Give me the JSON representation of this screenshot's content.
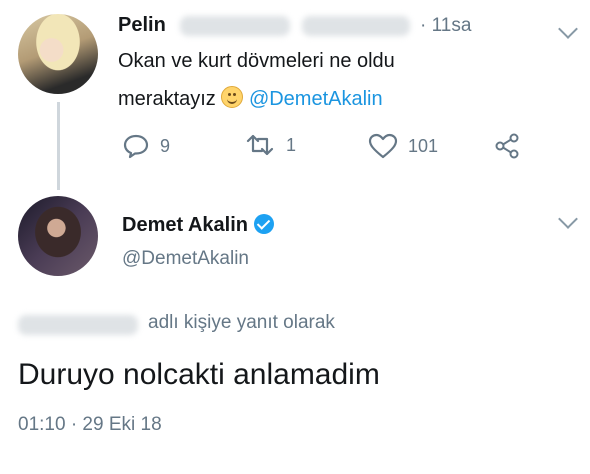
{
  "tweet1": {
    "name": "Pelin",
    "time": "· 11sa",
    "line1": "Okan ve kurt dövmeleri ne oldu",
    "line2": "meraktayız",
    "mention": "@DemetAkalin",
    "reply_count": "9",
    "retweet_count": "1",
    "like_count": "101"
  },
  "tweet2": {
    "name": "Demet Akalin",
    "handle": "@DemetAkalin",
    "reply_suffix": "adlı kişiye yanıt olarak",
    "text": "Duruyo nolcakti anlamadim",
    "timestamp": "01:10 · 29 Eki 18"
  },
  "icons": {
    "reply": "reply-icon",
    "retweet": "retweet-icon",
    "like": "heart-icon",
    "share": "share-icon",
    "more": "chevron-down-icon",
    "verified": "verified-badge-icon"
  }
}
